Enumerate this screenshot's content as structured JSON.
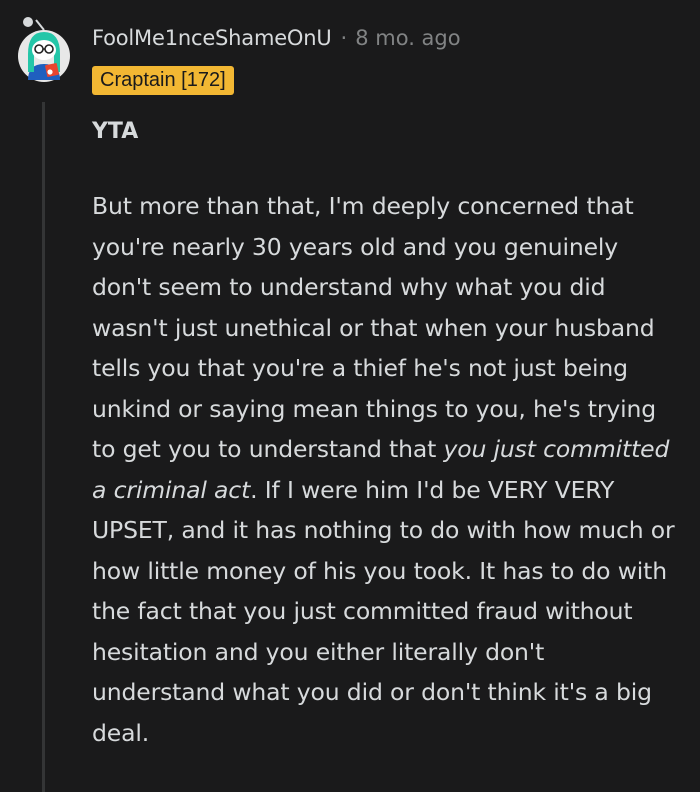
{
  "comment": {
    "username": "FoolMe1nceShameOnU",
    "separator": "·",
    "timestamp": "8 mo. ago",
    "flair": "Craptain [172]",
    "verdict": "YTA",
    "body": {
      "part1": "But more than that, I'm deeply concerned that you're nearly 30 years old and you genuinely don't seem to understand why what you did wasn't just unethical or that when your husband tells you that you're a thief he's not just being unkind or saying mean things to you, he's trying to get you to understand that ",
      "emphasis": "you just committed a criminal act",
      "part2": ". If I were him I'd be VERY VERY UPSET, and it has nothing to do with how much or how little money of his you took. It has to do with the fact that you just committed fraud without hesitation and you either literally don't understand what you did or don't think it's a big deal."
    }
  },
  "colors": {
    "background": "#1a1a1b",
    "text": "#d7dadc",
    "muted": "#818384",
    "flair_bg": "#f2b733",
    "thread_line": "#343536"
  },
  "icons": {
    "avatar": "snoo-avatar-icon"
  }
}
